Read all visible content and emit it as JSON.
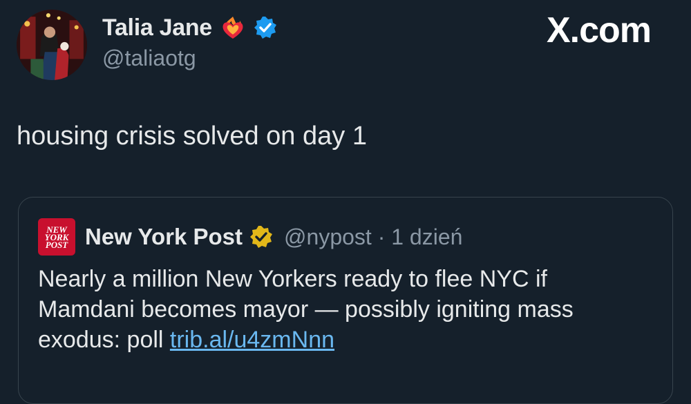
{
  "author": {
    "display_name": "Talia Jane",
    "handle": "@taliaotg",
    "emoji_icon": "heart-on-fire-icon",
    "badge": "verified-blue-icon"
  },
  "brand": {
    "label": "X.com"
  },
  "tweet": {
    "text": "housing crisis solved on day 1"
  },
  "quoted": {
    "logo_lines": [
      "NEW",
      "YORK",
      "POST"
    ],
    "display_name": "New York Post",
    "badge": "verified-gold-icon",
    "handle": "@nypost",
    "separator": "·",
    "time": "1 dzień",
    "text": "Nearly a million New Yorkers ready to flee NYC if Mamdani becomes mayor — possibly igniting mass exodus: poll ",
    "link": "trib.al/u4zmNnn"
  },
  "colors": {
    "background": "#15202b",
    "text": "#e7e9ea",
    "secondary": "#8b98a5",
    "link": "#6ab8f0",
    "verified_blue": "#1d9bf0",
    "verified_gold": "#e2b719",
    "nypost_red": "#c8102e"
  }
}
